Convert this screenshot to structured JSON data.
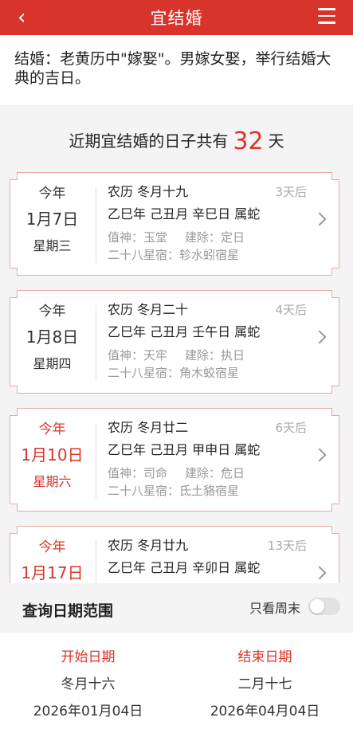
{
  "header": {
    "back_icon": "‹",
    "title": "宜结婚"
  },
  "intro": {
    "text": "结婚：老黄历中\"嫁娶\"。男嫁女娶，举行结婚大典的吉日。"
  },
  "summary": {
    "prefix": "近期宜结婚的日子共有",
    "count": "32",
    "suffix": "天"
  },
  "days": [
    {
      "year": "今年",
      "date": "1月7日",
      "weekday": "星期三",
      "weekend": false,
      "lunar": "农历 冬月十九",
      "ago": "3天后",
      "ganzhi": "乙巳年 己丑月 辛巳日 属蛇",
      "zhishen": "值神：玉堂",
      "jianchu": "建除：定日",
      "xiu": "二十八星宿：轸水蚓宿星"
    },
    {
      "year": "今年",
      "date": "1月8日",
      "weekday": "星期四",
      "weekend": false,
      "lunar": "农历 冬月二十",
      "ago": "4天后",
      "ganzhi": "乙巳年 己丑月 壬午日 属蛇",
      "zhishen": "值神：天牢",
      "jianchu": "建除：执日",
      "xiu": "二十八星宿：角木蛟宿星"
    },
    {
      "year": "今年",
      "date": "1月10日",
      "weekday": "星期六",
      "weekend": true,
      "lunar": "农历 冬月廿二",
      "ago": "6天后",
      "ganzhi": "乙巳年 己丑月 甲申日 属蛇",
      "zhishen": "值神：司命",
      "jianchu": "建除：危日",
      "xiu": "二十八星宿：氐土貉宿星"
    },
    {
      "year": "今年",
      "date": "1月17日",
      "weekday": "",
      "weekend": true,
      "lunar": "农历 冬月廿九",
      "ago": "13天后",
      "ganzhi": "乙巳年 己丑月 辛卯日 属蛇",
      "zhishen": "",
      "jianchu": "",
      "xiu": ""
    }
  ],
  "range": {
    "title": "查询日期范围",
    "weekend_only_label": "只看周末",
    "weekend_only": false,
    "start": {
      "label": "开始日期",
      "lunar": "冬月十六",
      "date": "2026年01月04日"
    },
    "end": {
      "label": "结束日期",
      "lunar": "二月十七",
      "date": "2026年04月04日"
    }
  },
  "colors": {
    "accent": "#d9342b",
    "card_border": "#e6aaa6",
    "muted": "#999999"
  }
}
